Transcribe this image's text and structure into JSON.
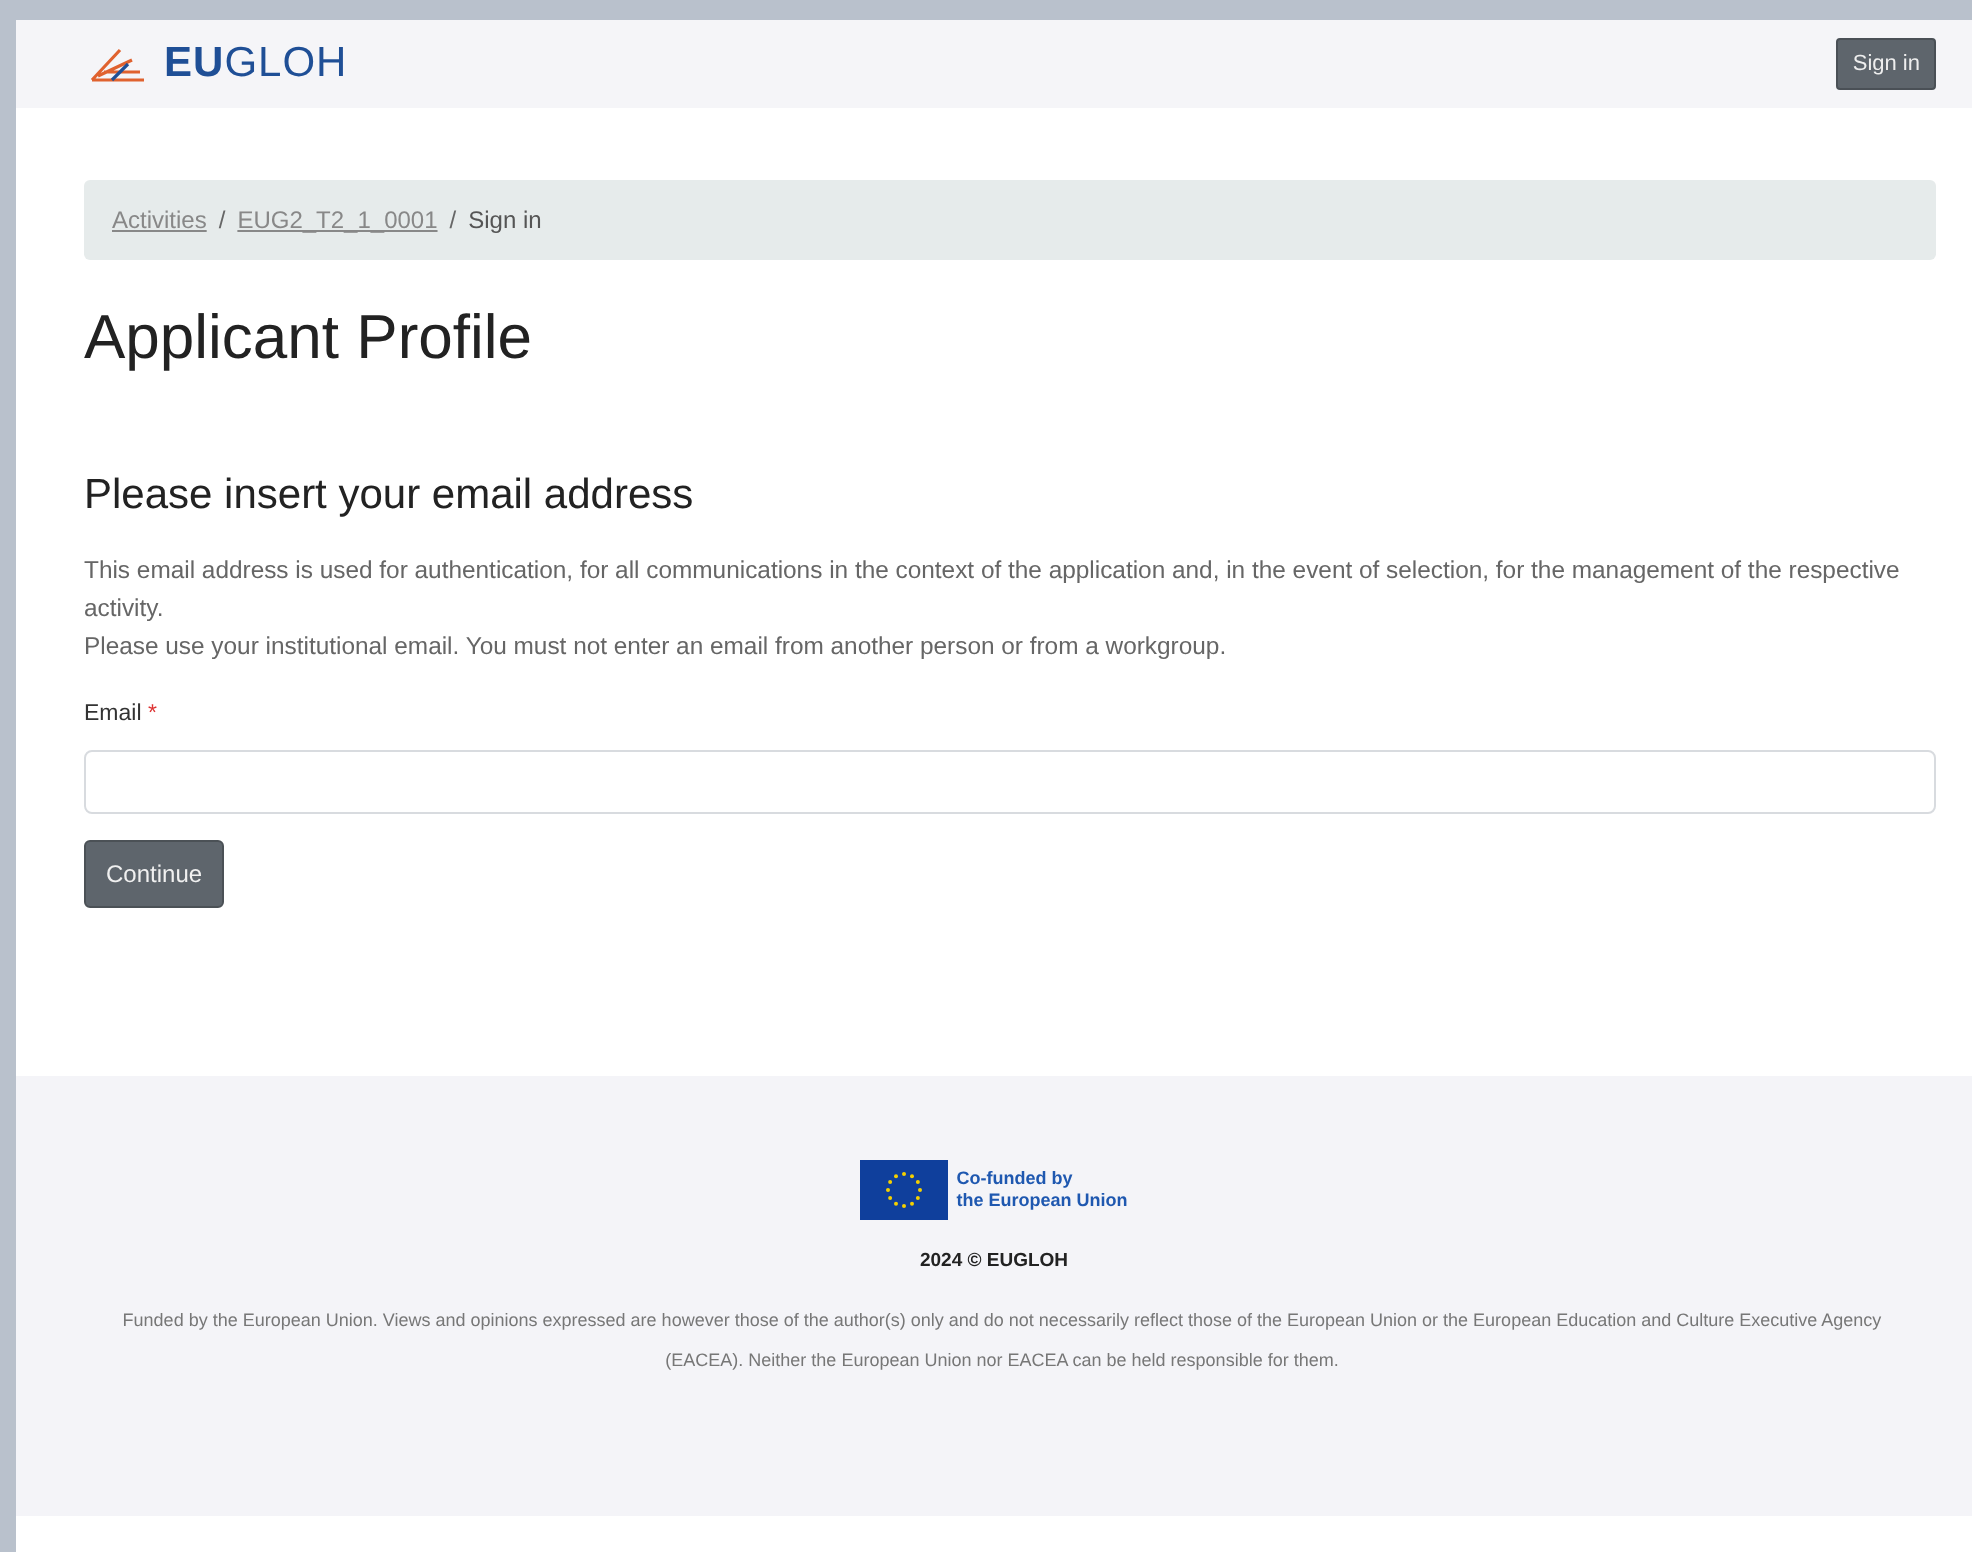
{
  "navbar": {
    "logo": "**EU**GLOH",
    "button": "Sign in"
  },
  "breadcrumb": [
    {
      "label": "Activities",
      "kind": "link"
    },
    {
      "label": "EUG2_T2_1_0001",
      "kind": "link",
      "separator": "/"
    },
    {
      "label": "Sign in",
      "kind": "current",
      "separator": "/"
    }
  ],
  "title": "Applicant Profile",
  "form": {
    "heading": "Please insert your email address",
    "paragraphs": [
      "This email address is used for authentication, for all communications in the context of the application and, in the event of selection, for the management of the respective activity.",
      "Please use your institutional email. You must not enter an email from another person or from a workgroup."
    ],
    "field": {
      "label": "Email",
      "required": true,
      "required_mark": "*"
    },
    "button": "Continue"
  },
  "footer": {
    "eu_logo_text": [
      "Co-funded by",
      "the European Union"
    ],
    "copyright": "2024 © EUGLOH",
    "disclaimer": "Funded by the European Union. Views and opinions expressed are however those of the author(s) only and do not necessarily reflect those of the European Union or the European Education and Culture Executive Agency (EACEA). Neither the European Union nor EACEA can be held responsible for them."
  }
}
